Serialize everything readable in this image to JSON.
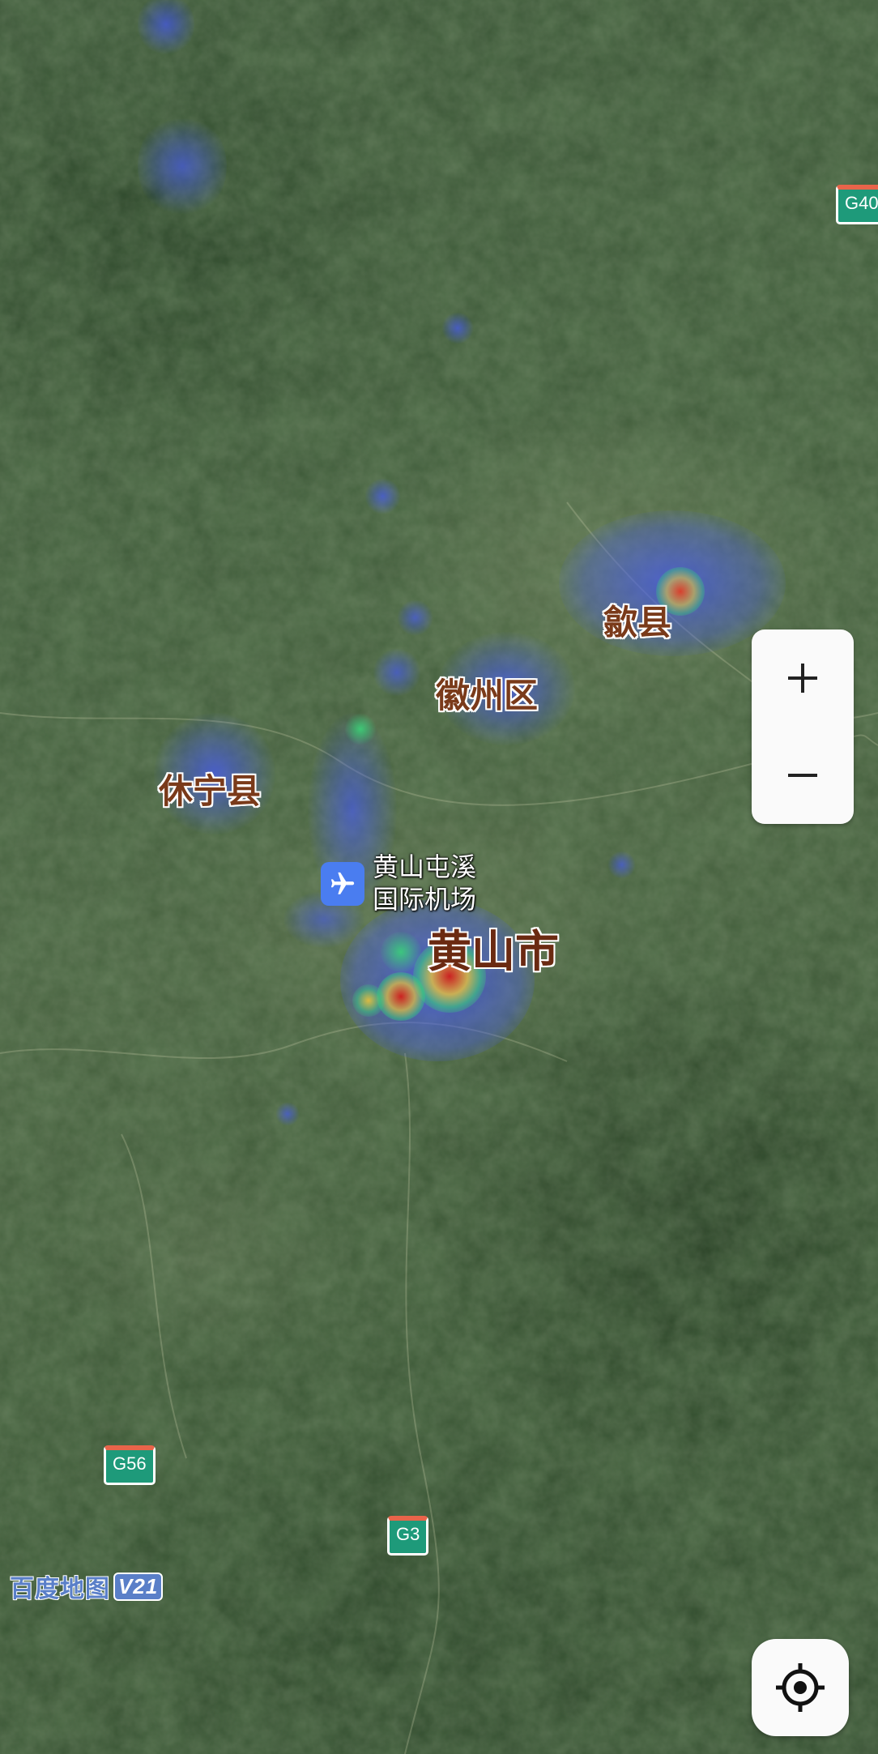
{
  "map": {
    "type": "satellite heatmap",
    "labels": {
      "shexian": "歙县",
      "huizhou": "徽州区",
      "xiuning": "休宁县",
      "airport_line1": "黄山屯溪",
      "airport_line2": "国际机场",
      "city": "黄山市"
    },
    "road_shields": {
      "g40": "G40",
      "g56": "G56",
      "g3": "G3"
    },
    "icons": {
      "airport": "airplane-icon",
      "zoom_in": "plus-icon",
      "zoom_out": "minus-icon",
      "locate": "crosshair-icon"
    },
    "logo": {
      "text": "百度地图",
      "version": "V21"
    },
    "heat_colors": {
      "low": "#4a5ae8",
      "mid": "#3ad07a",
      "high": "#e8c23a",
      "peak": "#d0221a"
    }
  },
  "controls": {
    "zoom_in_label": "+",
    "zoom_out_label": "−"
  }
}
